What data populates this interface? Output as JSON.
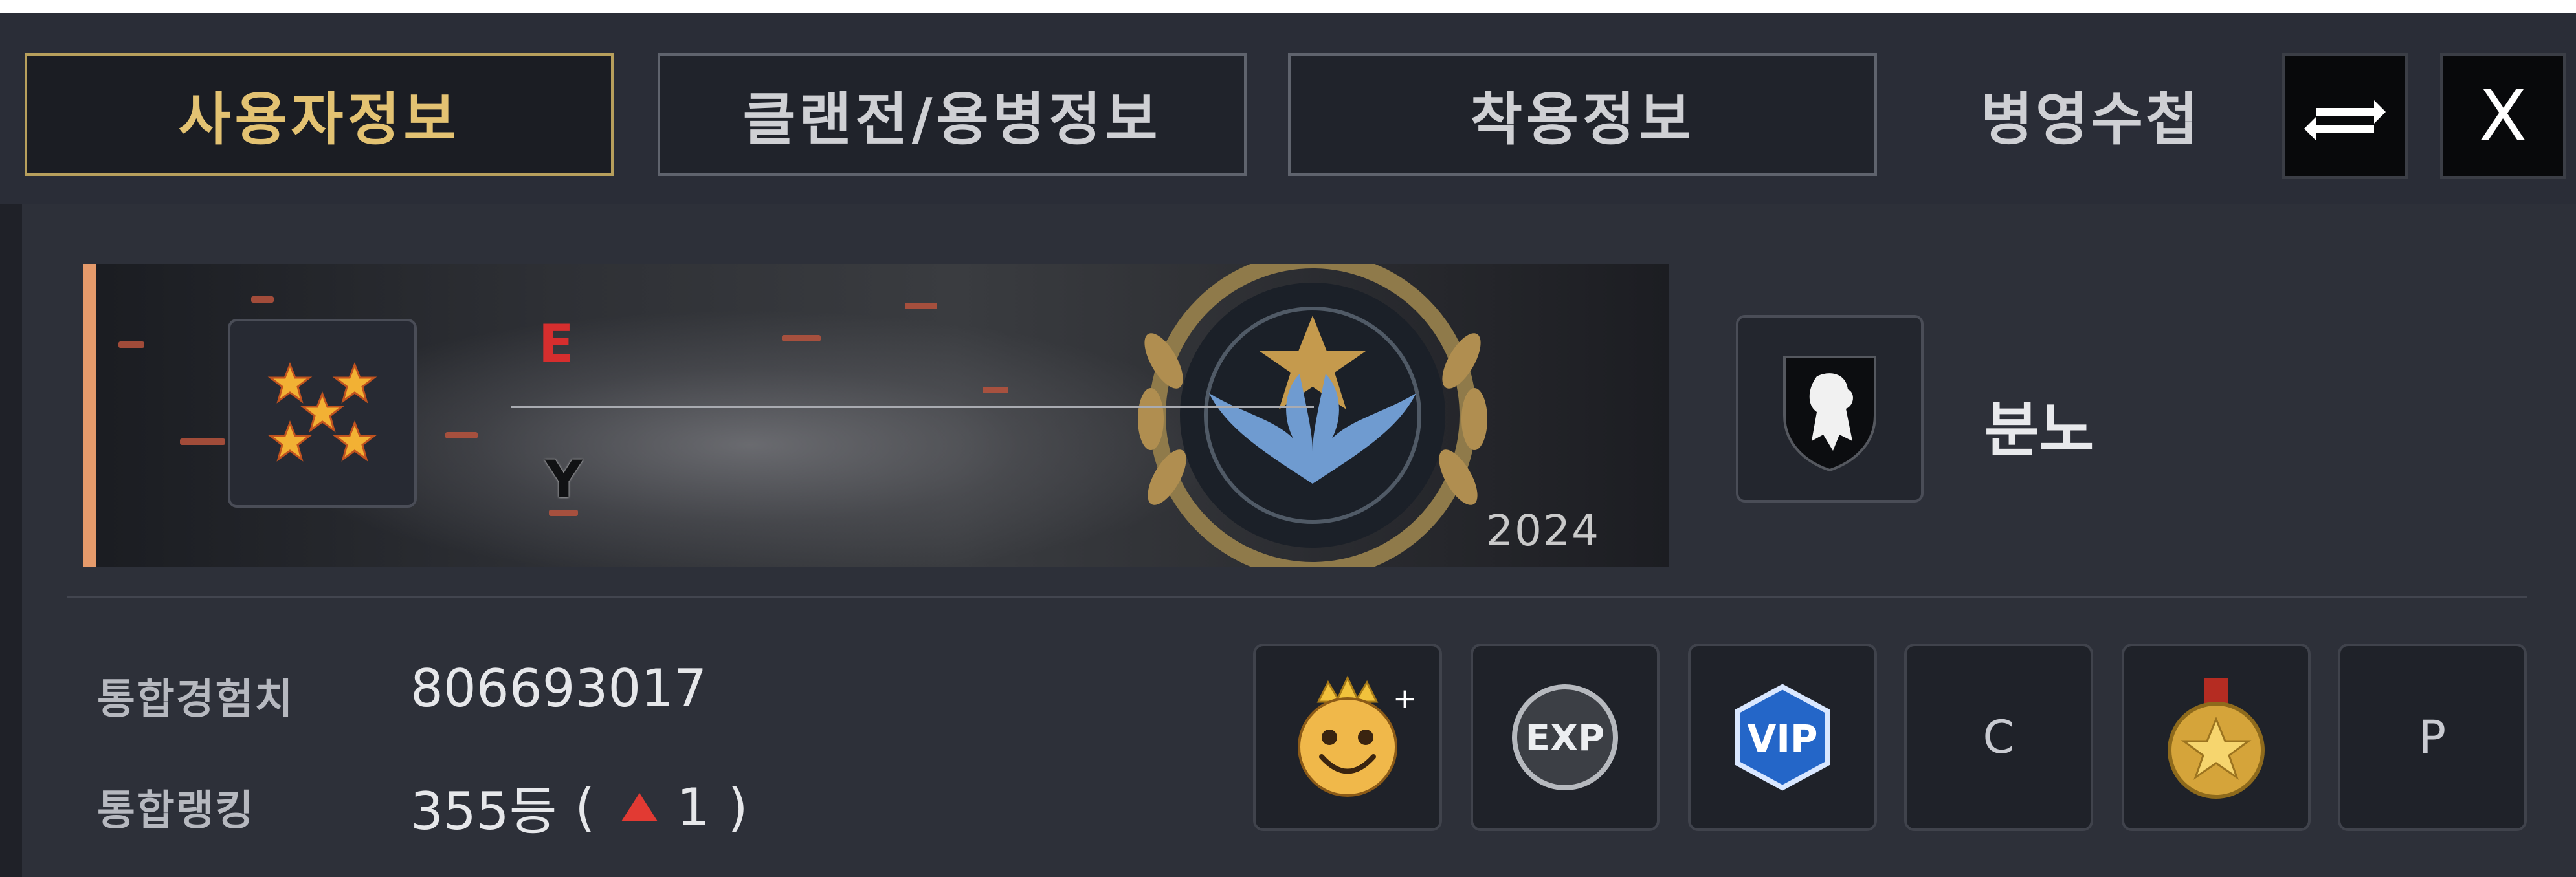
{
  "tabs": [
    {
      "label": "사용자정보",
      "active": true
    },
    {
      "label": "클랜전/용병정보",
      "active": false
    },
    {
      "label": "착용정보",
      "active": false
    },
    {
      "label": "병영수첩",
      "active": false
    }
  ],
  "header_buttons": {
    "swap": {
      "icon": "swap-arrows-icon"
    },
    "close": {
      "label": "X"
    }
  },
  "profile": {
    "rank_icon": "five-star-rank-icon",
    "name_top_letter": "E",
    "name_bottom_letter": "Y",
    "badge_year": "2024",
    "badge_icon": "laurel-wreath-wings-star-emblem",
    "clan_icon": "lion-crest-icon",
    "clan_name": "분노"
  },
  "stats": {
    "exp_label": "통합경험치",
    "exp_value": "806693017",
    "rank_label": "통합랭킹",
    "rank_value": "355등",
    "rank_change_open": "(",
    "rank_change_value": "1",
    "rank_change_close": ")"
  },
  "items": [
    {
      "icon": "crown-smiley-icon"
    },
    {
      "icon": "exp-badge-icon",
      "text": "EXP"
    },
    {
      "icon": "vip-badge-icon",
      "text": "VIP"
    },
    {
      "icon": "c-letter-icon",
      "text": "C"
    },
    {
      "icon": "gold-medal-icon"
    },
    {
      "icon": "p-letter-icon",
      "text": "P"
    }
  ],
  "colors": {
    "active_tab_border": "#b79f5c",
    "active_tab_text": "#e3c272",
    "banner_accent": "#e59a6b",
    "rank_up": "#e23a33"
  }
}
